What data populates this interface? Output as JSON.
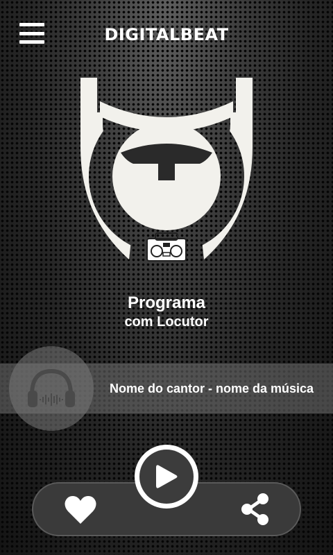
{
  "header": {
    "title": "DIGITALBEAT",
    "menu_icon": "hamburger-menu-icon"
  },
  "logo": {
    "icon": "digitalbeat-logo-icon",
    "color": "#f2f1ec"
  },
  "program": {
    "title": "Programa",
    "host": "com Locutor"
  },
  "now_playing": {
    "song": "Nome do cantor - nome da música",
    "cover_icon": "headphones-icon"
  },
  "controls": {
    "like_icon": "heart-icon",
    "play_icon": "play-icon",
    "share_icon": "share-icon"
  },
  "colors": {
    "accent": "#ffffff",
    "bar": "#3a3a3a",
    "play_ring": "#ffffff"
  }
}
